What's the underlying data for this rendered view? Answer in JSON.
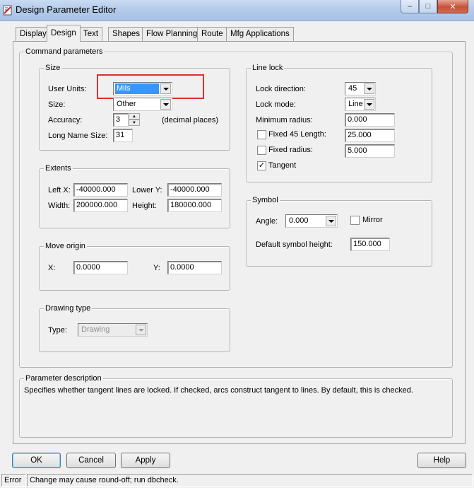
{
  "window": {
    "title": "Design Parameter Editor",
    "controls": {
      "minimize": "–",
      "maximize": "□",
      "close": "✕"
    }
  },
  "tabs": [
    {
      "label": "Display",
      "active": false
    },
    {
      "label": "Design",
      "active": true
    },
    {
      "label": "Text",
      "active": false
    },
    {
      "label": "Shapes",
      "active": false
    },
    {
      "label": "Flow Planning",
      "active": false
    },
    {
      "label": "Route",
      "active": false
    },
    {
      "label": "Mfg Applications",
      "active": false
    }
  ],
  "command_parameters": {
    "title": "Command parameters",
    "size": {
      "title": "Size",
      "user_units_label": "User Units:",
      "user_units_value": "Mils",
      "size_label": "Size:",
      "size_value": "Other",
      "accuracy_label": "Accuracy:",
      "accuracy_value": "3",
      "accuracy_suffix": "(decimal places)",
      "long_name_label": "Long Name Size:",
      "long_name_value": "31"
    },
    "extents": {
      "title": "Extents",
      "left_x_label": "Left X:",
      "left_x_value": "-40000.000",
      "lower_y_label": "Lower Y:",
      "lower_y_value": "-40000.000",
      "width_label": "Width:",
      "width_value": "200000.000",
      "height_label": "Height:",
      "height_value": "180000.000"
    },
    "move_origin": {
      "title": "Move origin",
      "x_label": "X:",
      "x_value": "0.0000",
      "y_label": "Y:",
      "y_value": "0.0000"
    },
    "drawing_type": {
      "title": "Drawing type",
      "type_label": "Type:",
      "type_value": "Drawing"
    },
    "line_lock": {
      "title": "Line lock",
      "lock_direction_label": "Lock direction:",
      "lock_direction_value": "45",
      "lock_mode_label": "Lock mode:",
      "lock_mode_value": "Line",
      "min_radius_label": "Minimum radius:",
      "min_radius_value": "0.000",
      "fixed45_label": "Fixed 45 Length:",
      "fixed45_checked": false,
      "fixed45_value": "25.000",
      "fixed_radius_label": "Fixed radius:",
      "fixed_radius_checked": false,
      "fixed_radius_value": "5.000",
      "tangent_label": "Tangent",
      "tangent_checked": true,
      "check_mark": "✓"
    },
    "symbol": {
      "title": "Symbol",
      "angle_label": "Angle:",
      "angle_value": "0.000",
      "mirror_label": "Mirror",
      "mirror_checked": false,
      "default_height_label": "Default symbol height:",
      "default_height_value": "150.000"
    }
  },
  "parameter_description": {
    "title": "Parameter description",
    "text": "Specifies whether tangent lines are locked. If checked, arcs construct tangent to lines. By default, this is checked."
  },
  "buttons": {
    "ok": "OK",
    "cancel": "Cancel",
    "apply": "Apply",
    "help": "Help"
  },
  "status": {
    "state": "Error",
    "message": "Change may cause round-off; run dbcheck."
  },
  "colors": {
    "highlight": "#e03030",
    "selection": "#3399ff"
  }
}
